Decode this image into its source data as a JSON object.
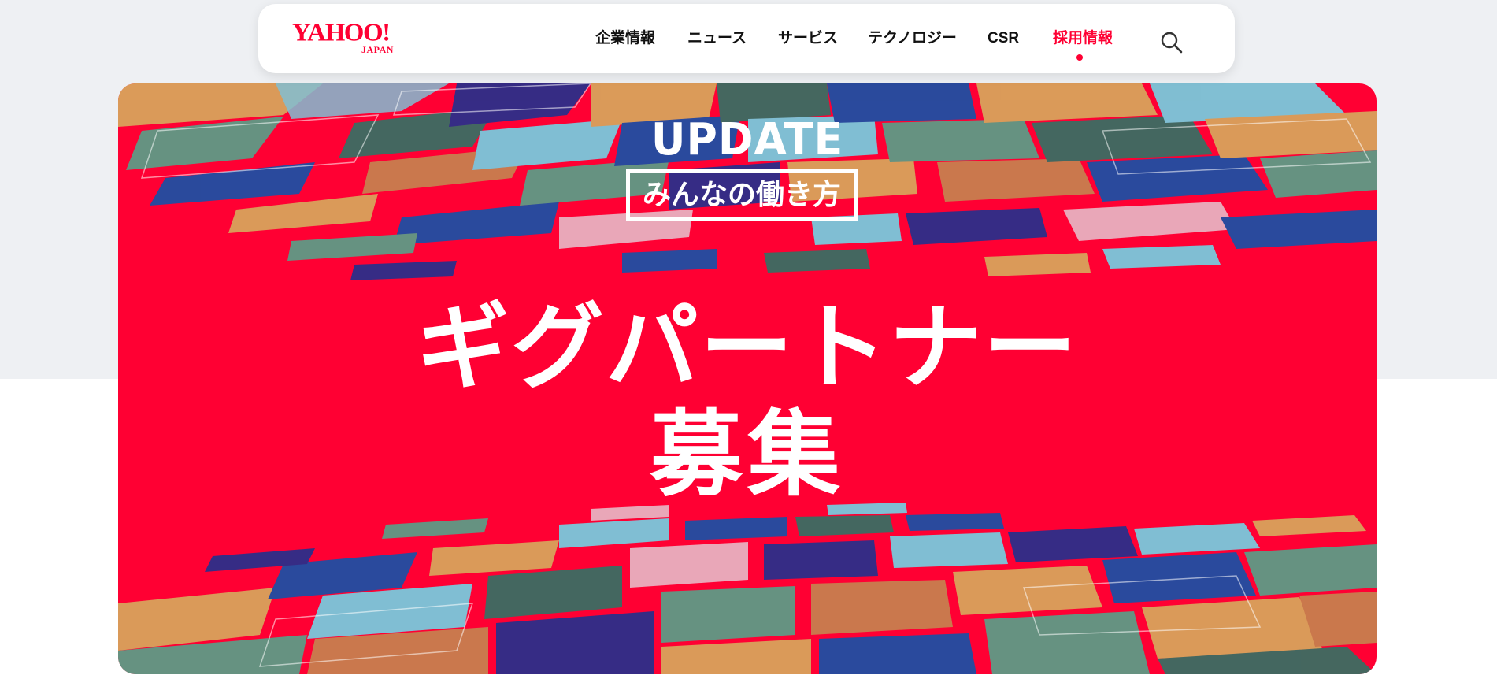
{
  "header": {
    "logo_main": "YAHOO!",
    "logo_sub": "JAPAN",
    "nav": [
      {
        "label": "企業情報",
        "active": false
      },
      {
        "label": "ニュース",
        "active": false
      },
      {
        "label": "サービス",
        "active": false
      },
      {
        "label": "テクノロジー",
        "active": false
      },
      {
        "label": "CSR",
        "active": false
      },
      {
        "label": "採用情報",
        "active": true
      }
    ],
    "search_icon": "search-icon"
  },
  "hero": {
    "kicker": "UPDATE",
    "boxed_label": "みんなの働き方",
    "title_line1": "ギグパートナー",
    "title_line2": "募集"
  },
  "colors": {
    "brand": "#ff0033",
    "hero_background": "#ff0033",
    "page_background_top": "#eef0f3",
    "nav_text": "#111111",
    "tile_palette": [
      "#1f4ea3",
      "#d9a35c",
      "#5e9a86",
      "#7ac9dc",
      "#2c2f8a",
      "#e8b0c0",
      "#3b6d63",
      "#c87f4f"
    ]
  }
}
